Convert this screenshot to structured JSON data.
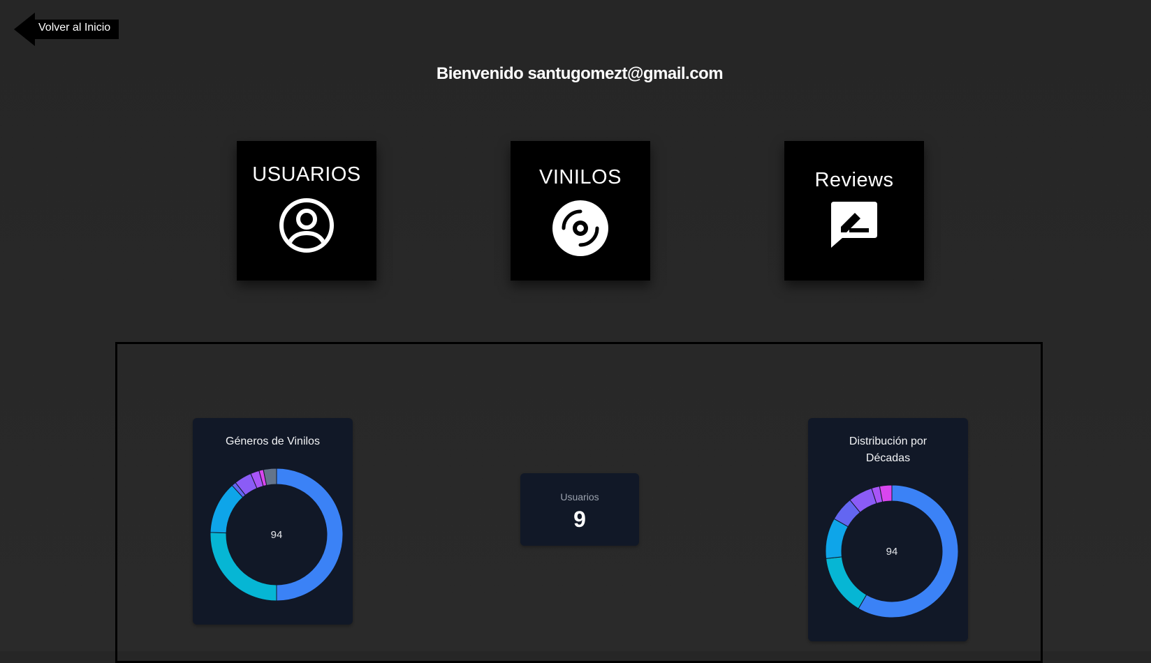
{
  "nav": {
    "back_label": "Volver al Inicio"
  },
  "header": {
    "welcome": "Bienvenido santugomezt@gmail.com"
  },
  "tiles": [
    {
      "label": "USUARIOS",
      "icon": "user-circle-icon"
    },
    {
      "label": "VINILOS",
      "icon": "vinyl-disc-icon"
    },
    {
      "label": "Reviews",
      "icon": "review-edit-icon"
    }
  ],
  "stats": {
    "users_label": "Usuarios",
    "users_value": "9"
  },
  "colors": {
    "background": "#262626",
    "tile": "#000000",
    "card": "#111827",
    "blue": "#3b82f6",
    "cyan": "#06b6d4",
    "sky": "#0ea5e9",
    "indigo": "#6366f1",
    "violet": "#8b5cf6",
    "purple": "#a855f7",
    "fuchsia": "#d946ef",
    "slate": "#64748b",
    "gray": "#6b7280"
  },
  "chart_data": [
    {
      "type": "donut",
      "title": "Géneros de Vinilos",
      "center_label": "94",
      "total": 94,
      "values": [
        47,
        24,
        12,
        1,
        4,
        2,
        1,
        3
      ],
      "colors": [
        "#3b82f6",
        "#06b6d4",
        "#0ea5e9",
        "#6366f1",
        "#8b5cf6",
        "#a855f7",
        "#d946ef",
        "#64748b"
      ]
    },
    {
      "type": "donut",
      "title": "Distribución por Décadas",
      "center_label": "94",
      "total": 94,
      "values": [
        59,
        15,
        10,
        6,
        6,
        2,
        3
      ],
      "colors": [
        "#3b82f6",
        "#06b6d4",
        "#0ea5e9",
        "#6366f1",
        "#8b5cf6",
        "#a855f7",
        "#d946ef"
      ]
    }
  ]
}
